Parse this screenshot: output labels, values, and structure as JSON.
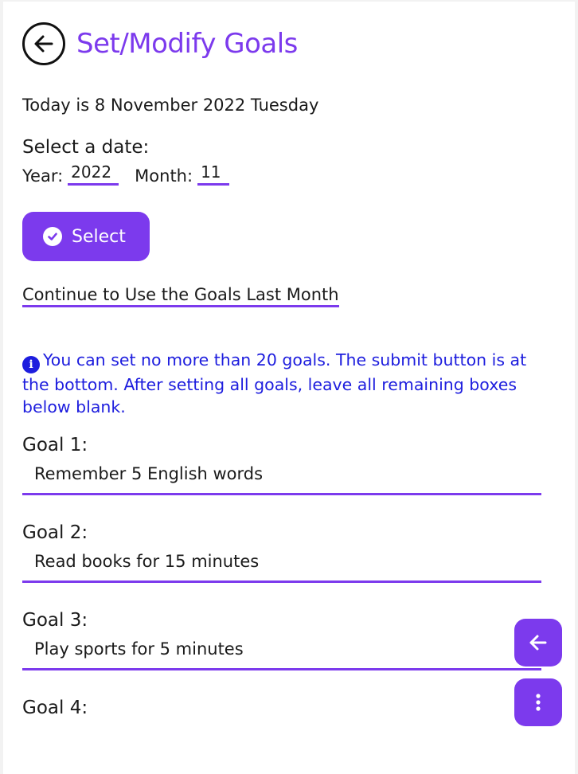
{
  "header": {
    "title": "Set/Modify Goals",
    "back_icon": "arrow-left-circle-icon"
  },
  "today_text": "Today is 8 November 2022 Tuesday",
  "date_selector": {
    "heading": "Select a date:",
    "year_label": "Year:",
    "year_value": "2022",
    "month_label": "Month:",
    "month_value": "11",
    "select_button_label": "Select"
  },
  "continue_link": "Continue to Use the Goals Last Month",
  "info_text": "You can set no more than 20 goals. The submit button is at the bottom. After setting all goals, leave all remaining boxes below blank.",
  "goals": [
    {
      "label": "Goal 1:",
      "value": "Remember 5 English words"
    },
    {
      "label": "Goal 2:",
      "value": "Read books for 15 minutes"
    },
    {
      "label": "Goal 3:",
      "value": "Play sports for 5 minutes"
    },
    {
      "label": "Goal 4:",
      "value": ""
    }
  ],
  "colors": {
    "accent": "#7c3aed",
    "info": "#1d1dde",
    "active_underline": "#6ee36e"
  }
}
